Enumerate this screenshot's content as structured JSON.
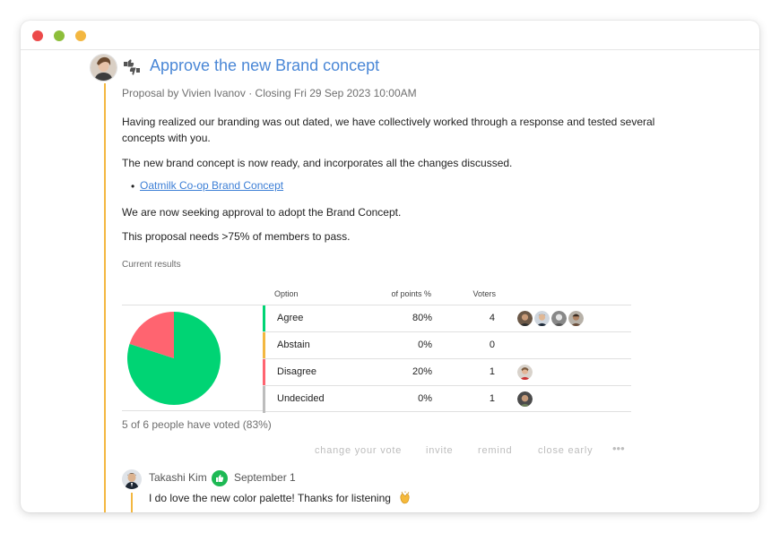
{
  "window": {
    "controls": [
      "close",
      "minimize",
      "maximize"
    ]
  },
  "proposal": {
    "title": "Approve the new Brand concept",
    "meta": "Proposal by Vivien Ivanov · Closing Fri 29 Sep 2023 10:00AM",
    "paragraphs": [
      "Having realized our branding was out dated, we have collectively worked through a response and tested several concepts with you.",
      "The new brand concept is now ready, and incorporates all the changes discussed.",
      "We are now seeking approval to adopt the Brand Concept.",
      "This proposal needs >75% of members to pass."
    ],
    "bullet": "•",
    "link_text": "Oatmilk Co-op Brand Concept",
    "icon": "thumbs-up-down-icon"
  },
  "results": {
    "label": "Current results",
    "columns": {
      "option": "Option",
      "points": "% of points",
      "voters": "Voters"
    },
    "rows": [
      {
        "option": "Agree",
        "points": "80%",
        "voters": "4",
        "color": "#00d474",
        "voter_avatars": 4
      },
      {
        "option": "Abstain",
        "points": "0%",
        "voters": "0",
        "color": "#f3b740",
        "voter_avatars": 0
      },
      {
        "option": "Disagree",
        "points": "20%",
        "voters": "1",
        "color": "#ff6470",
        "voter_avatars": 1
      },
      {
        "option": "Undecided",
        "points": "0%",
        "voters": "1",
        "color": "#bdbdbd",
        "voter_avatars": 1
      }
    ],
    "voted_summary": "5 of 6 people have voted (83%)"
  },
  "chart_data": {
    "type": "pie",
    "categories": [
      "Agree",
      "Abstain",
      "Disagree",
      "Undecided"
    ],
    "values": [
      80,
      0,
      20,
      0
    ],
    "colors": [
      "#00d474",
      "#f3b740",
      "#ff6470",
      "#bdbdbd"
    ]
  },
  "actions": {
    "change_vote": "change your vote",
    "invite": "invite",
    "remind": "remind",
    "close_early": "close early",
    "more": "•••"
  },
  "comment": {
    "author": "Takashi Kim",
    "date": "September 1",
    "text": "I do love the new color palette! Thanks for listening",
    "badge_icon": "thumbs-up-icon",
    "emoji_icon": "clapping-hands-icon"
  }
}
